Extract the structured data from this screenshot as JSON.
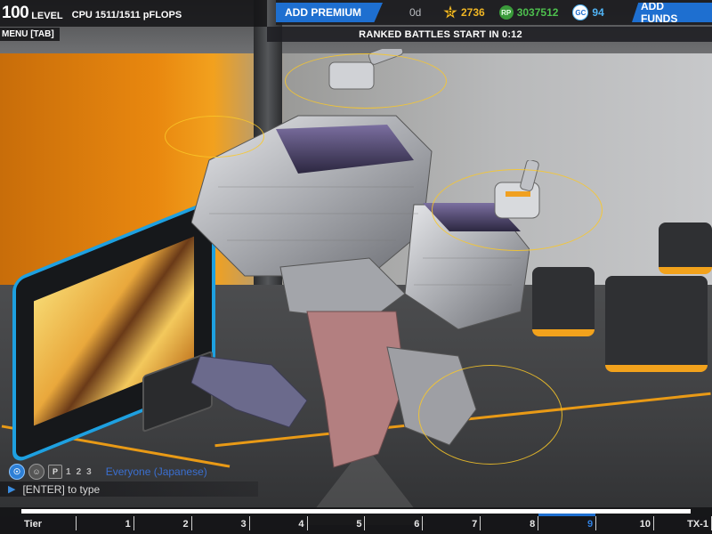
{
  "hud": {
    "level_number": "100",
    "level_word": "LEVEL",
    "cpu": "CPU 1511/1511 pFLOPS",
    "menu_tab": "MENU [TAB]",
    "add_premium": "ADD PREMIUM",
    "premium_days": "0d",
    "robits": "2736",
    "rp": "3037512",
    "gc": "94",
    "add_funds": "ADD FUNDS",
    "countdown": "RANKED BATTLES START IN 0:12",
    "robits_icon": "R",
    "rp_icon": "RP",
    "gc_icon": "GC"
  },
  "chat": {
    "icon_globe": "globe-icon",
    "party_label": "P",
    "num1": "1",
    "num2": "2",
    "num3": "3",
    "channel": "Everyone (Japanese)",
    "placeholder": "[ENTER] to type"
  },
  "tiers": {
    "label": "Tier",
    "items": [
      "1",
      "2",
      "3",
      "4",
      "5",
      "6",
      "7",
      "8",
      "9",
      "10",
      "TX-1"
    ],
    "active": "9"
  },
  "colors": {
    "accent_blue": "#1e6fd0",
    "robits_gold": "#f0b624",
    "rp_green": "#4ec04e",
    "gc_blue": "#50b3f4",
    "floor_orange": "#f2a21c"
  }
}
